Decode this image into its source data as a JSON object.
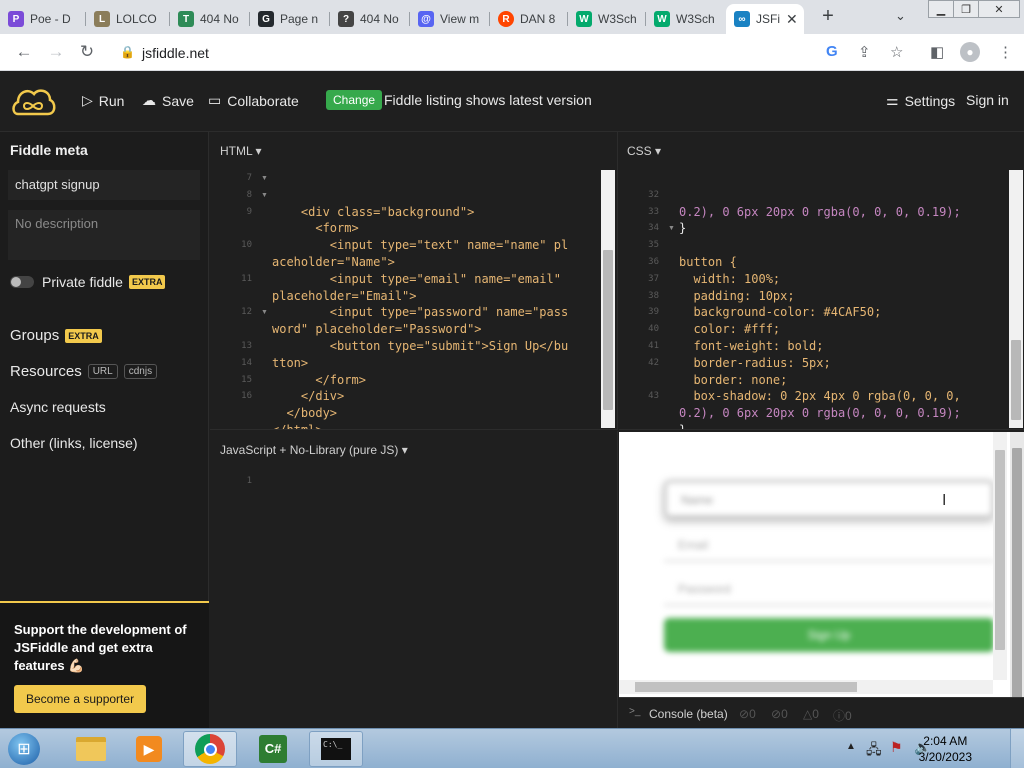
{
  "browser": {
    "tabs": [
      {
        "title": "Poe - D",
        "color": "#7b4bd8",
        "glyph": "P"
      },
      {
        "title": "LOLCO",
        "color": "#8b7d5a",
        "glyph": "L"
      },
      {
        "title": "404 No",
        "color": "#2e8b57",
        "glyph": "T"
      },
      {
        "title": "Page n",
        "color": "#24292e",
        "glyph": "G"
      },
      {
        "title": "404 No",
        "color": "#444444",
        "glyph": "?"
      },
      {
        "title": "View m",
        "color": "#5865f2",
        "glyph": "@"
      },
      {
        "title": "DAN 8",
        "color": "#ff4500",
        "glyph": "R"
      },
      {
        "title": "W3Sch",
        "color": "#04aa6d",
        "glyph": "W"
      },
      {
        "title": "W3Sch",
        "color": "#04aa6d",
        "glyph": "W"
      },
      {
        "title": "JSFi",
        "color": "#1a82c3",
        "glyph": "∞"
      }
    ],
    "url": "jsfiddle.net"
  },
  "header": {
    "run": "Run",
    "save": "Save",
    "collaborate": "Collaborate",
    "change": "Change",
    "listing": "Fiddle listing shows latest version",
    "settings": "Settings",
    "signin": "Sign in"
  },
  "sidebar": {
    "title": "Fiddle meta",
    "name_value": "chatgpt signup",
    "desc_placeholder": "No description",
    "private": "Private fiddle",
    "extra": "EXTRA",
    "groups": "Groups",
    "resources": "Resources",
    "url_chip": "URL",
    "cdnjs_chip": "cdnjs",
    "async": "Async requests",
    "other": "Other (links, license)",
    "support_text": "Support the development of JSFiddle and get extra features 💪🏻",
    "support_btn": "Become a supporter"
  },
  "panels": {
    "html_label": "HTML ▾",
    "css_label": "CSS ▾",
    "js_label": "JavaScript + No-Library (pure JS) ▾",
    "console_label": "Console (beta)",
    "console_counts": [
      "0",
      "0",
      "0",
      "0"
    ]
  },
  "html_code": {
    "line_numbers": [
      "7",
      "8",
      "9",
      "",
      "10",
      "",
      "11",
      "",
      "12",
      "",
      "13",
      "14",
      "15",
      "16"
    ],
    "lines": [
      "    <div class=\"background\">",
      "      <form>",
      "        <input type=\"text\" name=\"name\" pl",
      "aceholder=\"Name\">",
      "        <input type=\"email\" name=\"email\"",
      "placeholder=\"Email\">",
      "        <input type=\"password\" name=\"pass",
      "word\" placeholder=\"Password\">",
      "        <button type=\"submit\">Sign Up</bu",
      "tton>",
      "      </form>",
      "    </div>",
      "  </body>",
      "</html>"
    ]
  },
  "css_code": {
    "line_numbers": [
      "",
      "32",
      "33",
      "34",
      "35",
      "36",
      "37",
      "38",
      "39",
      "40",
      "41",
      "42",
      "",
      "43"
    ],
    "lines": [
      "0.2), 0 6px 20px 0 rgba(0, 0, 0, 0.19);",
      "}",
      "",
      "button {",
      "  width: 100%;",
      "  padding: 10px;",
      "  background-color: #4CAF50;",
      "  color: #fff;",
      "  font-weight: bold;",
      "  border-radius: 5px;",
      "  border: none;",
      "  box-shadow: 0 2px 4px 0 rgba(0, 0, 0,",
      "0.2), 0 6px 20px 0 rgba(0, 0, 0, 0.19);",
      "}"
    ]
  },
  "js_code": {
    "line_numbers": [
      "1"
    ]
  },
  "result": {
    "name_placeholder": "Name",
    "email_placeholder": "Email",
    "password_placeholder": "Password",
    "button_label": "Sign Up",
    "button_color": "#4CAF50"
  },
  "taskbar": {
    "time": "2:04 AM",
    "date": "3/20/2023"
  }
}
